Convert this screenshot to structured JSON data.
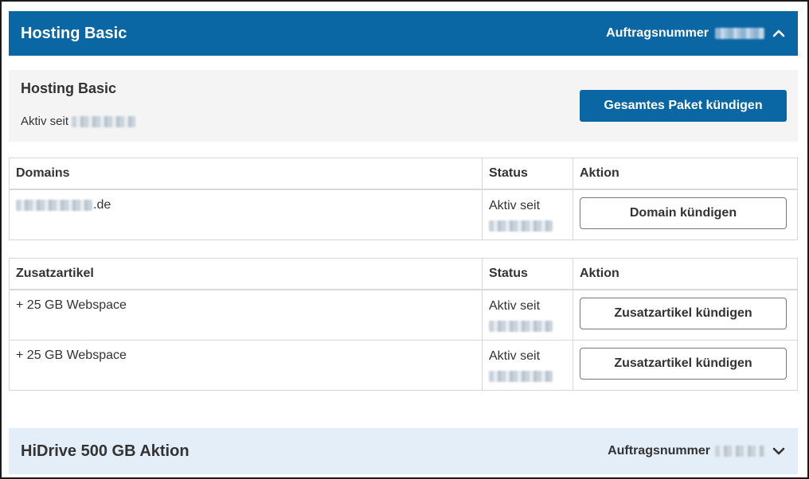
{
  "header": {
    "title": "Hosting Basic",
    "order_label": "Auftragsnummer",
    "toggle_icon": "chevron-up-icon"
  },
  "package": {
    "name": "Hosting Basic",
    "active_since_label": "Aktiv seit",
    "cancel_all_label": "Gesamtes Paket kündigen"
  },
  "domains_table": {
    "headers": [
      "Domains",
      "Status",
      "Aktion"
    ],
    "rows": [
      {
        "domain_suffix": ".de",
        "status": "Aktiv seit",
        "action": "Domain kündigen"
      }
    ]
  },
  "addons_table": {
    "headers": [
      "Zusatzartikel",
      "Status",
      "Aktion"
    ],
    "rows": [
      {
        "item": "+ 25 GB Webspace",
        "status": "Aktiv seit",
        "action": "Zusatzartikel kündigen"
      },
      {
        "item": "+ 25 GB Webspace",
        "status": "Aktiv seit",
        "action": "Zusatzartikel kündigen"
      }
    ]
  },
  "next_package": {
    "title": "HiDrive 500 GB Aktion",
    "order_label": "Auftragsnummer",
    "toggle_icon": "chevron-down-icon"
  },
  "colors": {
    "primary": "#0b67a4",
    "panel_bg": "#f4f4f4",
    "collapsed_bg": "#e3eef8"
  }
}
